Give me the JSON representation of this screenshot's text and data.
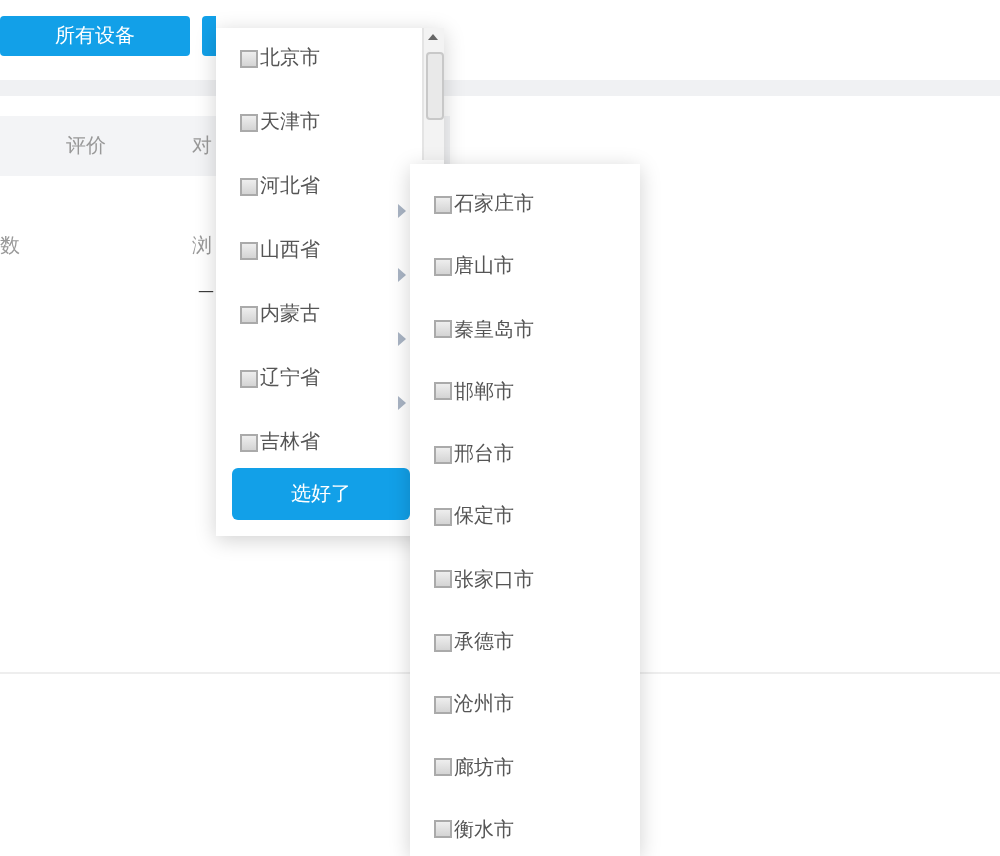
{
  "toolbar": {
    "buttons": [
      "所有设备"
    ]
  },
  "table": {
    "columns": [
      "评价",
      "对"
    ],
    "row_cells": [
      "数",
      "浏"
    ],
    "dash": "—"
  },
  "region_dropdown": {
    "items": [
      {
        "label": "北京市",
        "checked": false,
        "expandable": false
      },
      {
        "label": "天津市",
        "checked": false,
        "expandable": false
      },
      {
        "label": "河北省",
        "checked": false,
        "expandable": true
      },
      {
        "label": "山西省",
        "checked": false,
        "expandable": true
      },
      {
        "label": "内蒙古",
        "checked": false,
        "expandable": true
      },
      {
        "label": "辽宁省",
        "checked": false,
        "expandable": true
      },
      {
        "label": "吉林省",
        "checked": false,
        "expandable": false
      }
    ],
    "confirm_button": "选好了"
  },
  "city_submenu": {
    "items": [
      {
        "label": "石家庄市",
        "checked": false
      },
      {
        "label": "唐山市",
        "checked": false
      },
      {
        "label": "秦皇岛市",
        "checked": false
      },
      {
        "label": "邯郸市",
        "checked": false
      },
      {
        "label": "邢台市",
        "checked": false
      },
      {
        "label": "保定市",
        "checked": false
      },
      {
        "label": "张家口市",
        "checked": false
      },
      {
        "label": "承德市",
        "checked": false
      },
      {
        "label": "沧州市",
        "checked": false
      },
      {
        "label": "廊坊市",
        "checked": false
      },
      {
        "label": "衡水市",
        "checked": false
      }
    ]
  }
}
